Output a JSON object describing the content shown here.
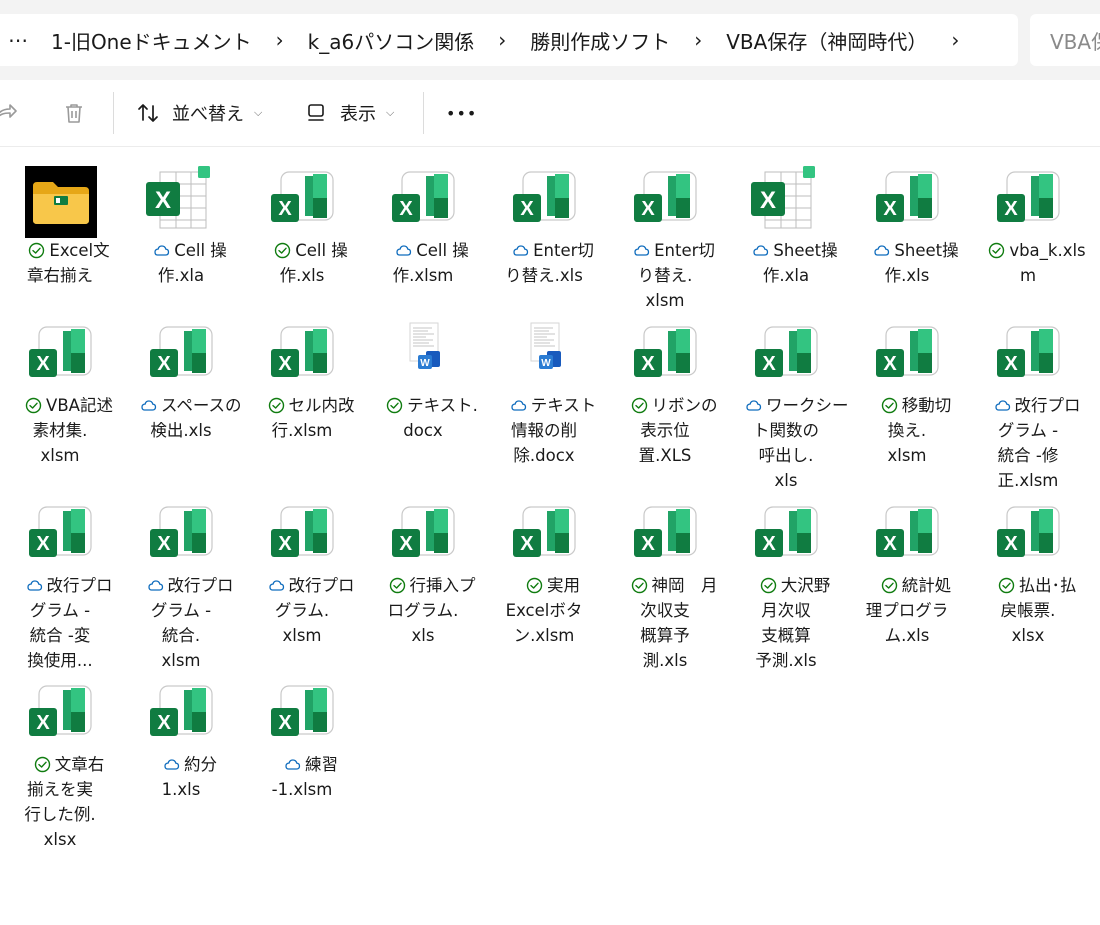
{
  "address_bar": {
    "overflow_label": "⋯",
    "breadcrumbs": [
      "1-旧Oneドキュメント",
      "k_a6パソコン関係",
      "勝則作成ソフト",
      "VBA保存（神岡時代）"
    ],
    "separator": "›",
    "search_placeholder": "VBA保存"
  },
  "toolbar": {
    "sort_label": "並べ替え",
    "view_label": "表示",
    "more_label": "•••"
  },
  "files": [
    {
      "lines": [
        "Excel文",
        "章右揃え"
      ],
      "icon": "folder",
      "status": "synced"
    },
    {
      "lines": [
        "Cell 操",
        "作.xla"
      ],
      "icon": "excel-addin",
      "status": "cloud"
    },
    {
      "lines": [
        "Cell 操",
        "作.xls"
      ],
      "icon": "excel",
      "status": "synced"
    },
    {
      "lines": [
        "Cell 操",
        "作.xlsm"
      ],
      "icon": "excel",
      "status": "cloud"
    },
    {
      "lines": [
        "Enter切",
        "り替え.xls"
      ],
      "icon": "excel",
      "status": "cloud"
    },
    {
      "lines": [
        "Enter切",
        "り替え.",
        "xlsm"
      ],
      "icon": "excel",
      "status": "cloud"
    },
    {
      "lines": [
        "Sheet操",
        "作.xla"
      ],
      "icon": "excel-addin",
      "status": "cloud"
    },
    {
      "lines": [
        "Sheet操",
        "作.xls"
      ],
      "icon": "excel",
      "status": "cloud"
    },
    {
      "lines": [
        "vba_k.xls",
        "m"
      ],
      "icon": "excel",
      "status": "synced"
    },
    {
      "lines": [
        "VBA記述",
        "素材集.",
        "xlsm"
      ],
      "icon": "excel",
      "status": "synced"
    },
    {
      "lines": [
        "スペースの",
        "検出.xls"
      ],
      "icon": "excel",
      "status": "cloud"
    },
    {
      "lines": [
        "セル内改",
        "行.xlsm"
      ],
      "icon": "excel",
      "status": "synced"
    },
    {
      "lines": [
        "テキスト.",
        "docx"
      ],
      "icon": "word",
      "status": "synced"
    },
    {
      "lines": [
        "テキスト",
        "情報の削",
        "除.docx"
      ],
      "icon": "word",
      "status": "cloud"
    },
    {
      "lines": [
        "リボンの",
        "表示位",
        "置.XLS"
      ],
      "icon": "excel",
      "status": "synced"
    },
    {
      "lines": [
        "ワークシー",
        "ト関数の",
        "呼出し.",
        "xls"
      ],
      "icon": "excel",
      "status": "cloud"
    },
    {
      "lines": [
        "移動切",
        "換え.",
        "xlsm"
      ],
      "icon": "excel",
      "status": "synced"
    },
    {
      "lines": [
        "改行プロ",
        "グラム -",
        "統合 -修",
        "正.xlsm"
      ],
      "icon": "excel",
      "status": "cloud"
    },
    {
      "lines": [
        "改行プロ",
        "グラム -",
        "統合 -変",
        "換使用..."
      ],
      "icon": "excel",
      "status": "cloud"
    },
    {
      "lines": [
        "改行プロ",
        "グラム -",
        "統合.",
        "xlsm"
      ],
      "icon": "excel",
      "status": "cloud"
    },
    {
      "lines": [
        "改行プロ",
        "グラム.",
        "xlsm"
      ],
      "icon": "excel",
      "status": "cloud"
    },
    {
      "lines": [
        "行挿入プ",
        "ログラム.",
        "xls"
      ],
      "icon": "excel",
      "status": "synced"
    },
    {
      "lines": [
        "実用",
        "Excelボタ",
        "ン.xlsm"
      ],
      "icon": "excel",
      "status": "synced"
    },
    {
      "lines": [
        "神岡　月",
        "次収支",
        "概算予",
        "測.xls"
      ],
      "icon": "excel",
      "status": "synced"
    },
    {
      "lines": [
        "大沢野",
        "月次収",
        "支概算",
        "予測.xls"
      ],
      "icon": "excel",
      "status": "synced"
    },
    {
      "lines": [
        "統計処",
        "理プログラ",
        "ム.xls"
      ],
      "icon": "excel",
      "status": "synced"
    },
    {
      "lines": [
        "払出･払",
        "戻帳票.",
        "xlsx"
      ],
      "icon": "excel",
      "status": "synced"
    },
    {
      "lines": [
        "文章右",
        "揃えを実",
        "行した例.",
        "xlsx"
      ],
      "icon": "excel",
      "status": "synced"
    },
    {
      "lines": [
        "約分",
        "1.xls"
      ],
      "icon": "excel",
      "status": "cloud"
    },
    {
      "lines": [
        "練習",
        "-1.xlsm"
      ],
      "icon": "excel",
      "status": "cloud"
    }
  ],
  "colors": {
    "excel_dark": "#107c41",
    "excel_light": "#33c481",
    "excel_mid": "#21a366",
    "synced_green": "#107c10",
    "cloud_blue": "#0f6cbd",
    "folder_yellow": "#f8c74a",
    "word_blue": "#185abd"
  }
}
